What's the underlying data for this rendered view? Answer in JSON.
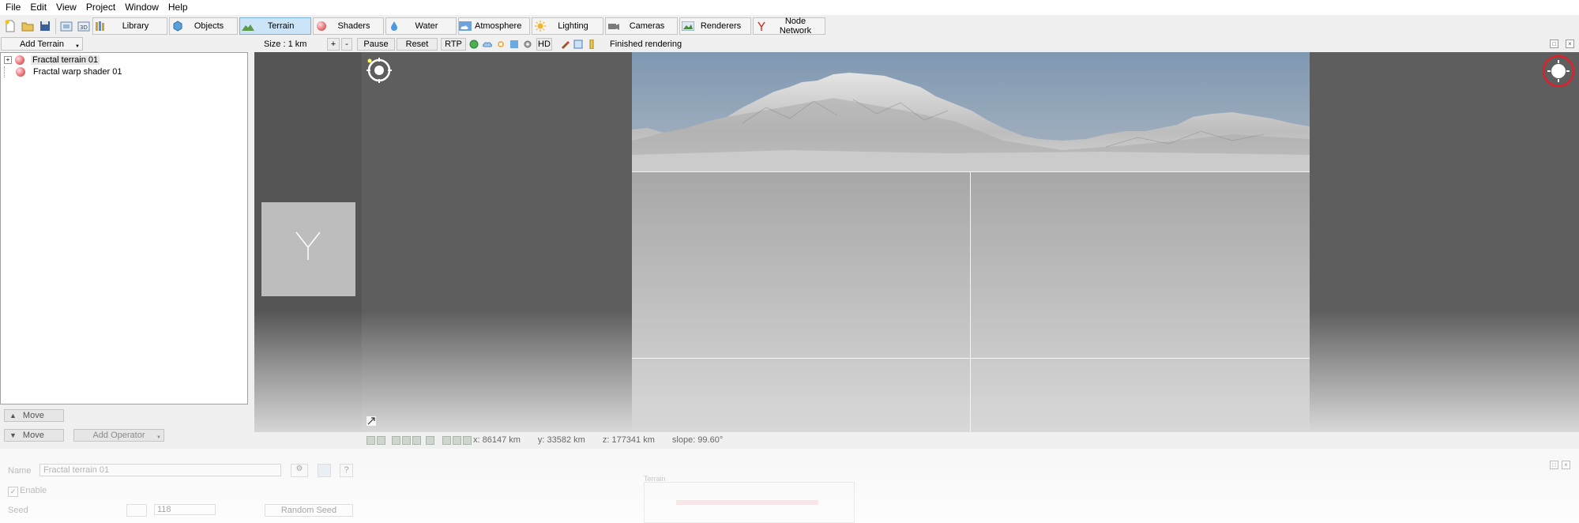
{
  "menu": [
    "File",
    "Edit",
    "View",
    "Project",
    "Window",
    "Help"
  ],
  "toolbar": {
    "tabs": [
      {
        "label": "Library",
        "icon": "library-icon",
        "active": false
      },
      {
        "label": "Objects",
        "icon": "objects-icon",
        "active": false
      },
      {
        "label": "Terrain",
        "icon": "terrain-icon",
        "active": true
      },
      {
        "label": "Shaders",
        "icon": "shaders-icon",
        "active": false
      },
      {
        "label": "Water",
        "icon": "water-icon",
        "active": false
      },
      {
        "label": "Atmosphere",
        "icon": "atmosphere-icon",
        "active": false
      },
      {
        "label": "Lighting",
        "icon": "lighting-icon",
        "active": false
      },
      {
        "label": "Cameras",
        "icon": "cameras-icon",
        "active": false
      },
      {
        "label": "Renderers",
        "icon": "renderers-icon",
        "active": false
      },
      {
        "label": "Node Network",
        "icon": "node-network-icon",
        "active": false
      }
    ]
  },
  "left": {
    "add_button": "Add Terrain",
    "tree": [
      {
        "label": "Fractal terrain 01",
        "expandable": true,
        "selected": true
      },
      {
        "label": "Fractal warp shader 01",
        "expandable": false,
        "selected": false
      }
    ],
    "move_up": "Move",
    "move_down": "Move",
    "add_operator": "Add Operator"
  },
  "renderbar": {
    "size": "Size : 1 km",
    "plus": "+",
    "minus": "-",
    "pause": "Pause",
    "reset": "Reset",
    "rtp": "RTP",
    "hd": "HD",
    "status": "Finished rendering"
  },
  "status": {
    "x": "x: 86147 km",
    "y": "y: 33582 km",
    "z": "z: 177341 km",
    "slope": "slope: 99.60°"
  },
  "bottom": {
    "name_label": "Name",
    "name_value": "Fractal terrain 01",
    "enable_label": "Enable",
    "seed_label": "Seed",
    "seed_value": "118",
    "random_seed": "Random Seed",
    "terrain_caption": "Terrain"
  },
  "colors": {
    "sky": "#8fa4b9",
    "active_tab": "#cce4f7",
    "highlight_ring": "#e0202a"
  }
}
